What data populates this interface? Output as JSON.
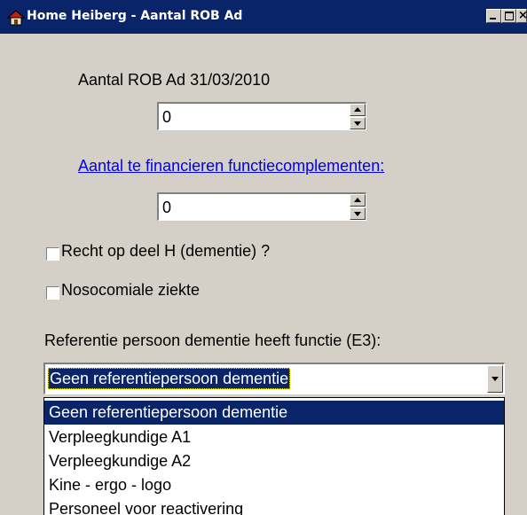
{
  "window": {
    "title": "Home Heiberg - Aantal ROB Ad",
    "icon": "house-icon",
    "controls": [
      "minimize-icon",
      "maximize-icon",
      "close-icon"
    ]
  },
  "form": {
    "rob_label": "Aantal ROB Ad 31/03/2010",
    "rob_value": "0",
    "complements_link": "Aantal te financieren functiecomplementen:",
    "complements_value": "0",
    "checkbox_dementie_label": "Recht op deel H (dementie) ?",
    "checkbox_dementie_checked": false,
    "checkbox_noso_label": "Nosocomiale ziekte",
    "checkbox_noso_checked": false,
    "reference_label": "Referentie persoon dementie heeft functie (E3):",
    "reference_selected": "Geen referentiepersoon dementie",
    "reference_options": [
      "Geen referentiepersoon dementie",
      "Verpleegkundige A1",
      "Verpleegkundige A2",
      "Kine - ergo - logo",
      "Personeel voor reactivering"
    ]
  },
  "colors": {
    "titlebar": "#0a246a",
    "face": "#d4d0c8",
    "selection": "#0a246a",
    "link": "#0000ee"
  }
}
